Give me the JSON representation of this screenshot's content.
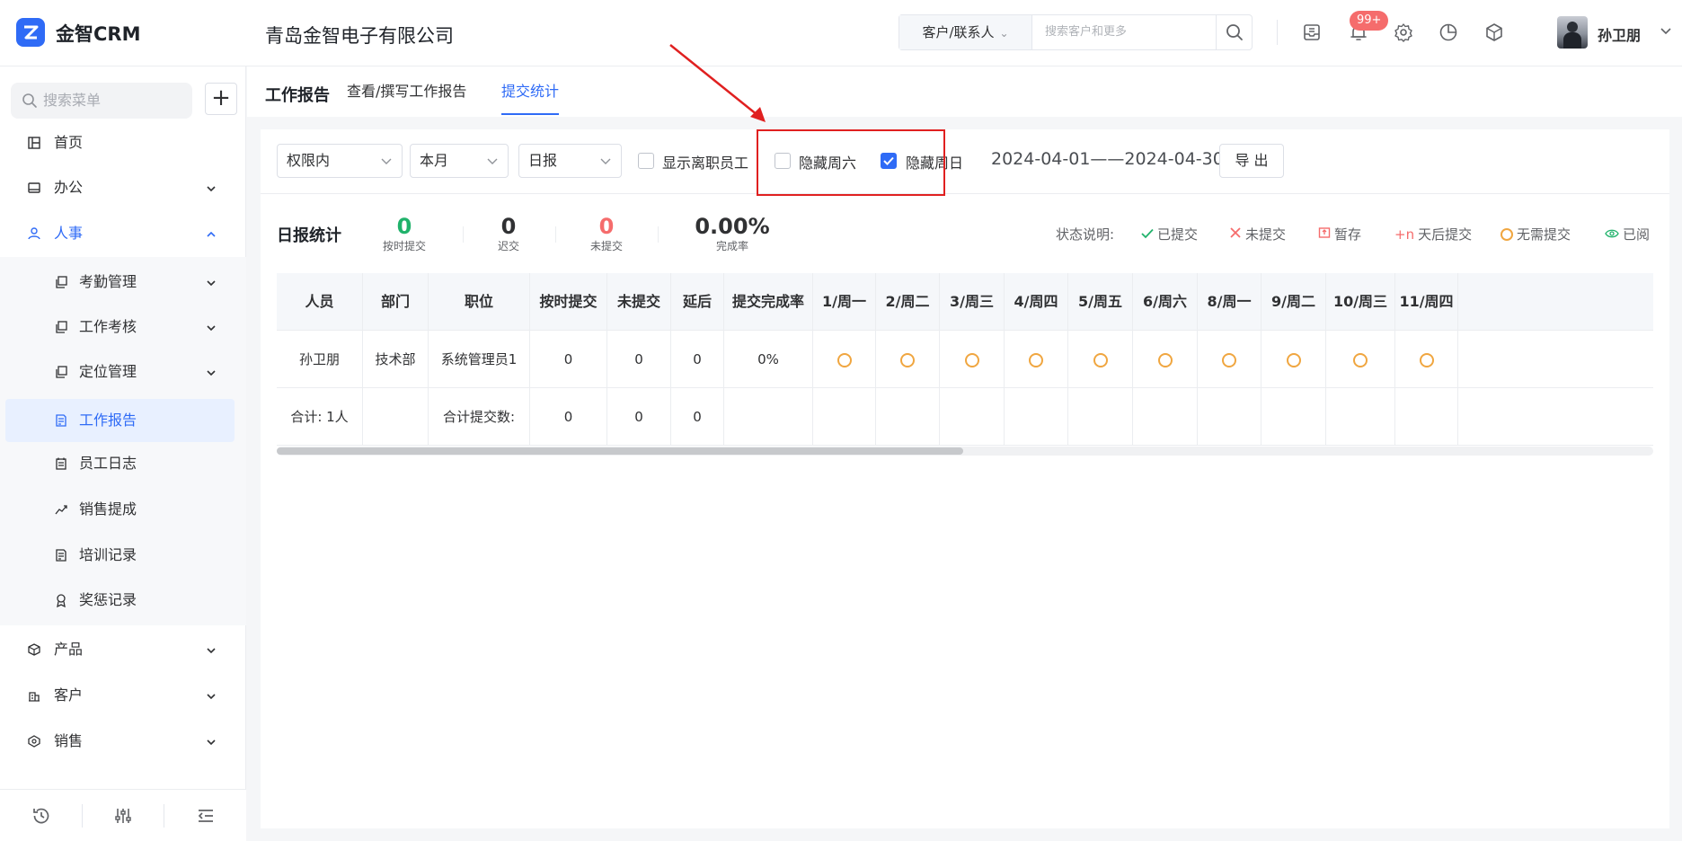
{
  "app": {
    "name": "金智CRM",
    "company": "青岛金智电子有限公司"
  },
  "header": {
    "search_type": "客户/联系人",
    "search_placeholder": "搜索客户和更多",
    "badge": "99+",
    "user": "孙卫朋"
  },
  "sidebar": {
    "search_placeholder": "搜索菜单",
    "items": [
      {
        "label": "首页",
        "icon": "home-icon"
      },
      {
        "label": "办公",
        "icon": "office-icon"
      },
      {
        "label": "人事",
        "icon": "people-icon"
      },
      {
        "label": "产品",
        "icon": "cube-icon"
      },
      {
        "label": "客户",
        "icon": "building-icon"
      },
      {
        "label": "销售",
        "icon": "sales-icon"
      }
    ],
    "sub_items": [
      {
        "label": "考勤管理",
        "icon": "copy-icon"
      },
      {
        "label": "工作考核",
        "icon": "copy-icon"
      },
      {
        "label": "定位管理",
        "icon": "copy-icon"
      },
      {
        "label": "工作报告",
        "icon": "report-icon"
      },
      {
        "label": "员工日志",
        "icon": "calendar-icon"
      },
      {
        "label": "销售提成",
        "icon": "trend-icon"
      },
      {
        "label": "培训记录",
        "icon": "report-icon"
      },
      {
        "label": "奖惩记录",
        "icon": "award-icon"
      }
    ]
  },
  "tabs": {
    "title": "工作报告",
    "items": [
      "查看/撰写工作报告",
      "提交统计"
    ],
    "active": "提交统计"
  },
  "filters": {
    "scope": "权限内",
    "period": "本月",
    "report_type": "日报",
    "show_resigned": "显示离职员工",
    "hide_saturday": "隐藏周六",
    "hide_sunday": "隐藏周日",
    "date_range": "2024-04-01——2024-04-30",
    "export": "导 出"
  },
  "stats": {
    "title": "日报统计",
    "on_time": {
      "value": "0",
      "label": "按时提交"
    },
    "late": {
      "value": "0",
      "label": "迟交"
    },
    "missing": {
      "value": "0",
      "label": "未提交"
    },
    "rate": {
      "value": "0.00%",
      "label": "完成率"
    }
  },
  "legend": {
    "title": "状态说明:",
    "items": [
      "已提交",
      "未提交",
      "暂存",
      "天后提交",
      "无需提交",
      "已阅"
    ],
    "plus_n": "+n"
  },
  "table": {
    "columns": [
      "人员",
      "部门",
      "职位",
      "按时提交",
      "未提交",
      "延后",
      "提交完成率",
      "1/周一",
      "2/周二",
      "3/周三",
      "4/周四",
      "5/周五",
      "6/周六",
      "8/周一",
      "9/周二",
      "10/周三",
      "11/周四"
    ],
    "rows": [
      [
        "孙卫朋",
        "技术部",
        "系统管理员1",
        "0",
        "0",
        "0",
        "0%"
      ]
    ],
    "total": [
      "合计:  1人",
      "",
      "合计提交数:",
      "0",
      "0",
      "0",
      ""
    ]
  },
  "colors": {
    "accent": "#2f6bf6",
    "success": "#20b26b",
    "danger": "#f56c6c",
    "warning": "#f0a640",
    "annotation": "#e02020"
  }
}
